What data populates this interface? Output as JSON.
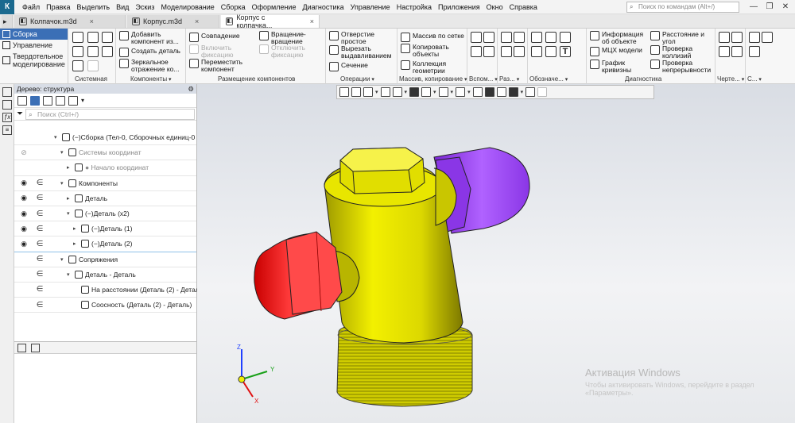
{
  "app": {
    "logo": "К"
  },
  "menu": [
    "Файл",
    "Правка",
    "Выделить",
    "Вид",
    "Эскиз",
    "Моделирование",
    "Сборка",
    "Оформление",
    "Диагностика",
    "Управление",
    "Настройка",
    "Приложения",
    "Окно",
    "Справка"
  ],
  "command_search": {
    "placeholder": "Поиск по командам (Alt+/)"
  },
  "window_controls": {
    "minimize": "—",
    "restore": "❐",
    "close": "✕"
  },
  "doc_tabs": [
    {
      "label": "Колпачок.m3d",
      "active": false
    },
    {
      "label": "Корпус.m3d",
      "active": false
    },
    {
      "label": "Корпус с колпачка...",
      "active": true
    }
  ],
  "modes": [
    "Сборка",
    "Управление",
    "Твердотельное моделирование"
  ],
  "ribbon": {
    "groups": {
      "sys": "Системная",
      "comp": "Компоненты",
      "place": "Размещение компонентов",
      "ops": "Операции",
      "array": "Массив, копирование",
      "aux": "Вспом...",
      "sz": "Раз...",
      "notes": "Обозначе...",
      "diag": "Диагностика",
      "draw": "Черте...",
      "c": "С..."
    },
    "buttons": {
      "add_component": "Добавить компонент из...",
      "create_part": "Создать деталь",
      "mirror": "Зеркальное отражение ко...",
      "coincide": "Совпадение",
      "enable_fix": "Включить фиксацию",
      "move_comp": "Переместить компонент",
      "rotate_rotate": "Вращение-вращение",
      "disable_fix": "Отключить фиксацию",
      "hole": "Отверстие простое",
      "cut_extrude": "Вырезать выдавливанием",
      "section": "Сечение",
      "grid_array": "Массив по сетке",
      "copy_objects": "Копировать объекты",
      "geom_collection": "Коллекция геометрии",
      "info": "Информация об объекте",
      "mcx": "МЦХ модели",
      "curvature": "График кривизны",
      "distance": "Расстояние и угол",
      "collisions": "Проверка коллизий",
      "continuity": "Проверка непрерывности"
    }
  },
  "tree_panel": {
    "title": "Дерево: структура",
    "search_placeholder": "Поиск (Ctrl+/)",
    "rows": [
      {
        "text": "(−)Сборка (Тел-0, Сборочных единиц-0",
        "indent": 1,
        "eye": "",
        "grey": false
      },
      {
        "text": "Системы координат",
        "indent": 2,
        "eye": "hidden",
        "grey": true
      },
      {
        "text": "● Начало координат",
        "indent": 3,
        "eye": "",
        "grey": true
      },
      {
        "text": "Компоненты",
        "indent": 2,
        "eye": "visible",
        "grey": false
      },
      {
        "text": "Деталь",
        "indent": 3,
        "eye": "visible",
        "grey": false
      },
      {
        "text": "(−)Деталь (x2)",
        "indent": 3,
        "eye": "visible",
        "grey": false
      },
      {
        "text": "(−)Деталь (1)",
        "indent": 4,
        "eye": "visible",
        "grey": false
      },
      {
        "text": "(−)Деталь (2)",
        "indent": 4,
        "eye": "visible",
        "grey": false
      },
      {
        "text": "Сопряжения",
        "indent": 2,
        "eye": "",
        "grey": false
      },
      {
        "text": "Деталь - Деталь",
        "indent": 3,
        "eye": "",
        "grey": false
      },
      {
        "text": "На расстоянии (Деталь (2)  -  Детал",
        "indent": 4,
        "eye": "",
        "grey": false
      },
      {
        "text": "Соосность (Деталь (2)  -  Деталь)",
        "indent": 4,
        "eye": "",
        "grey": false
      }
    ]
  },
  "axes": {
    "x": "X",
    "y": "Y",
    "z": "Z"
  },
  "watermark": {
    "title": "Активация Windows",
    "subtitle": "Чтобы активировать Windows, перейдите в раздел «Параметры»."
  },
  "colors": {
    "accent": "#3b6fb6",
    "body": "#e8e600",
    "cap_red": "#ff3030",
    "cap_purple": "#a545ff"
  }
}
